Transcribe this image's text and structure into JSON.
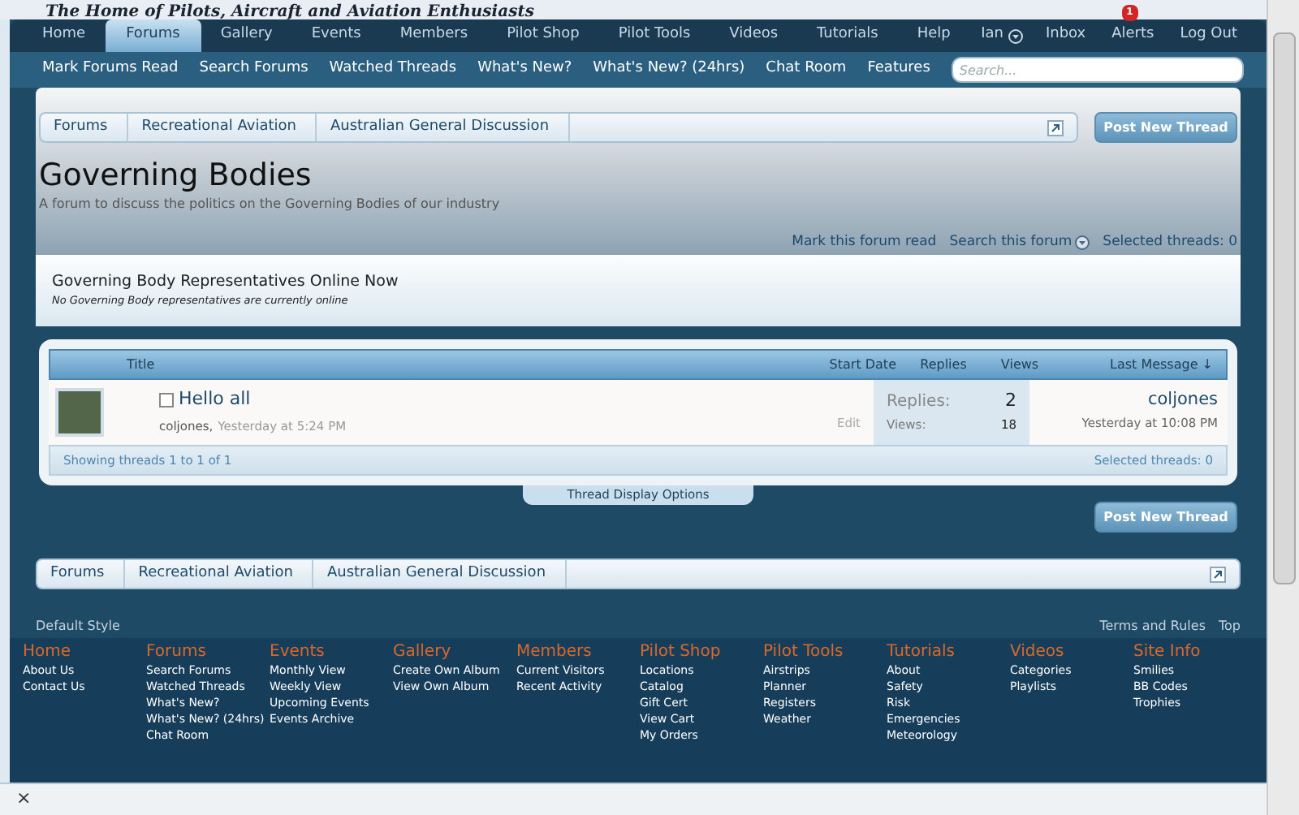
{
  "site_tagline": "The Home of Pilots, Aircraft and Aviation Enthusiasts",
  "nav_tabs": [
    {
      "label": "Home",
      "selected": false
    },
    {
      "label": "Forums",
      "selected": true
    },
    {
      "label": "Gallery",
      "selected": false
    },
    {
      "label": "Events",
      "selected": false
    },
    {
      "label": "Members",
      "selected": false
    },
    {
      "label": "Pilot Shop",
      "selected": false
    },
    {
      "label": "Pilot Tools",
      "selected": false
    },
    {
      "label": "Videos",
      "selected": false
    },
    {
      "label": "Tutorials",
      "selected": false
    },
    {
      "label": "Help",
      "selected": false
    }
  ],
  "user_nav": {
    "username": "Ian",
    "inbox": "Inbox",
    "alerts": "Alerts",
    "alerts_count": "1",
    "logout": "Log Out"
  },
  "sub_nav": [
    "Mark Forums Read",
    "Search Forums",
    "Watched Threads",
    "What's New?",
    "What's New? (24hrs)",
    "Chat Room",
    "Features"
  ],
  "search": {
    "placeholder": "Search..."
  },
  "breadcrumb": [
    "Forums",
    "Recreational Aviation",
    "Australian General Discussion"
  ],
  "post_button": "Post New Thread",
  "forum": {
    "title": "Governing Bodies",
    "description": "A forum to discuss the politics on the Governing Bodies of our industry"
  },
  "forum_links": [
    "Mark this forum read",
    "Search this forum",
    "Selected threads: 0"
  ],
  "notice": {
    "title": "Governing Body Representatives Online Now",
    "text": "No Governing Body representatives are currently online"
  },
  "table": {
    "columns": [
      "Title",
      "Start Date",
      "Replies",
      "Views",
      "Last Message ↓"
    ],
    "rows": [
      {
        "title": "Hello all",
        "checked": false,
        "author": "coljones,",
        "date": "Yesterday at 5:24 PM",
        "edit": "Edit",
        "replies_label": "Replies:",
        "replies": "2",
        "views_label": "Views:",
        "views": "18",
        "last_user": "coljones",
        "last_date": "Yesterday at 10:08 PM"
      }
    ],
    "footer_left": "Showing threads 1 to 1 of 1",
    "footer_right": "Selected threads: 0"
  },
  "display_options": "Thread Display Options",
  "post_button_bottom": "Post New Thread",
  "breadcrumb_bottom": [
    "Forums",
    "Recreational Aviation",
    "Australian General Discussion"
  ],
  "page_footer": {
    "style": "Default Style",
    "links": [
      "Terms and Rules",
      "Top"
    ]
  },
  "footer_columns": [
    {
      "heading": "Home",
      "items": [
        "About Us",
        "Contact Us"
      ]
    },
    {
      "heading": "Forums",
      "items": [
        "Search Forums",
        "Watched Threads",
        "What's New?",
        "What's New? (24hrs)",
        "Chat Room"
      ]
    },
    {
      "heading": "Events",
      "items": [
        "Monthly View",
        "Weekly View",
        "Upcoming Events",
        "Events Archive"
      ]
    },
    {
      "heading": "Gallery",
      "items": [
        "Create Own Album",
        "View Own Album"
      ]
    },
    {
      "heading": "Members",
      "items": [
        "Current Visitors",
        "Recent Activity"
      ]
    },
    {
      "heading": "Pilot Shop",
      "items": [
        "Locations",
        "Catalog",
        "Gift Cert",
        "View Cart",
        "My Orders"
      ]
    },
    {
      "heading": "Pilot Tools",
      "items": [
        "Airstrips",
        "Planner",
        "Registers",
        "Weather"
      ]
    },
    {
      "heading": "Tutorials",
      "items": [
        "About",
        "Safety",
        "Risk",
        "Emergencies",
        "Meteorology"
      ]
    },
    {
      "heading": "Videos",
      "items": [
        "Categories",
        "Playlists"
      ]
    },
    {
      "heading": "Site Info",
      "items": [
        "Smilies",
        "BB Codes",
        "Trophies"
      ]
    }
  ],
  "bottom_bar": {
    "close": "×"
  }
}
